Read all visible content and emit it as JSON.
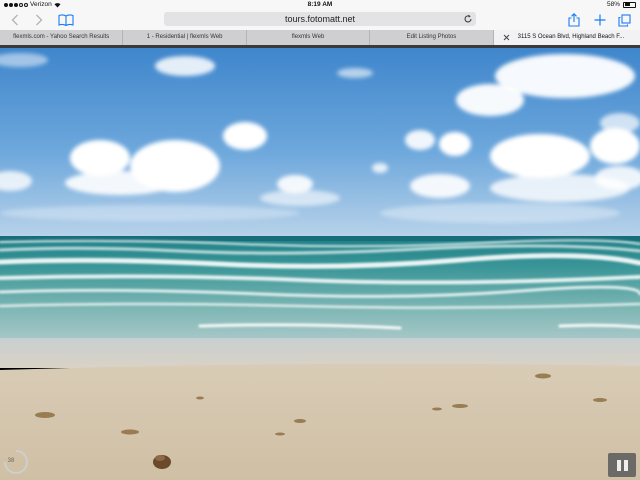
{
  "status_bar": {
    "carrier": "Verizon",
    "time": "8:19 AM",
    "battery_percent": "58%",
    "battery_level": 0.58
  },
  "toolbar": {
    "url": "tours.fotomatt.net",
    "accent_color": "#1a7cf5"
  },
  "tabs": [
    {
      "label": "flexmls.com - Yahoo Search Results"
    },
    {
      "label": "1 - Residential | flexmls Web"
    },
    {
      "label": "flexmls Web"
    },
    {
      "label": "Edit Listing Photos"
    },
    {
      "label": "3115 S Ocean Blvd, Highland Beach F..."
    }
  ],
  "slideshow": {
    "counter": "38"
  }
}
